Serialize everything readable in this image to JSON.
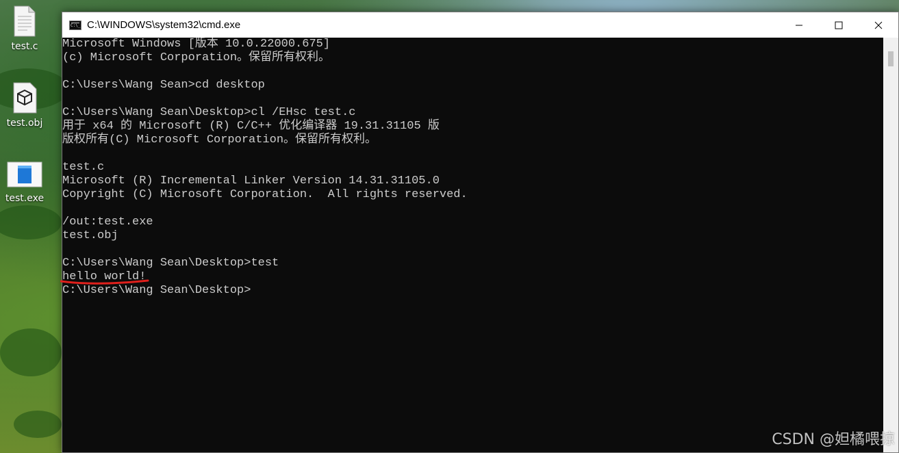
{
  "desktop": {
    "icons": [
      {
        "label": "test.c",
        "icon": "text-file-icon"
      },
      {
        "label": "test.obj",
        "icon": "object-file-icon"
      },
      {
        "label": "test.exe",
        "icon": "executable-file-icon"
      }
    ]
  },
  "window": {
    "title": "C:\\WINDOWS\\system32\\cmd.exe",
    "controls": [
      "minimize-icon",
      "maximize-icon",
      "close-icon"
    ]
  },
  "console": {
    "lines": [
      "Microsoft Windows [版本 10.0.22000.675]",
      "(c) Microsoft Corporation。保留所有权利。",
      "",
      "C:\\Users\\Wang Sean>cd desktop",
      "",
      "C:\\Users\\Wang Sean\\Desktop>cl /EHsc test.c",
      "用于 x64 的 Microsoft (R) C/C++ 优化编译器 19.31.31105 版",
      "版权所有(C) Microsoft Corporation。保留所有权利。",
      "",
      "test.c",
      "Microsoft (R) Incremental Linker Version 14.31.31105.0",
      "Copyright (C) Microsoft Corporation.  All rights reserved.",
      "",
      "/out:test.exe",
      "test.obj",
      "",
      "C:\\Users\\Wang Sean\\Desktop>test",
      "hello world!",
      "C:\\Users\\Wang Sean\\Desktop>"
    ]
  },
  "annotation": {
    "color": "#e0201c"
  },
  "watermark": "CSDN @妲橘喂掠"
}
